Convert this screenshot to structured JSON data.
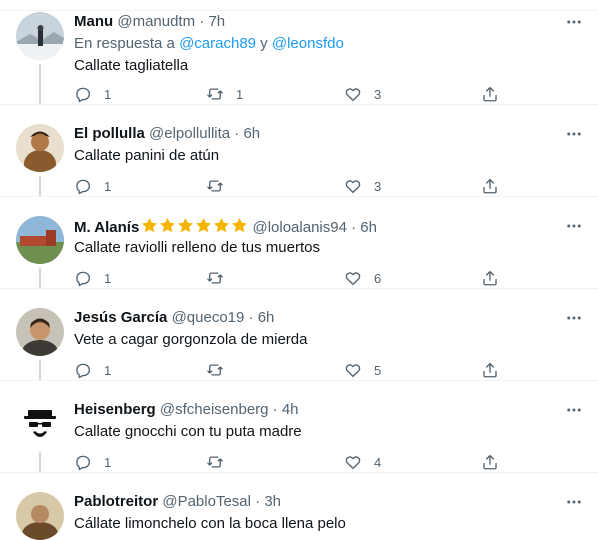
{
  "tweets": [
    {
      "name": "Manu",
      "handle": "@manudtm",
      "time": "7h",
      "reply_prefix": "En respuesta a ",
      "reply_mention_1": "@carach89",
      "reply_join": " y ",
      "reply_mention_2": "@leonsfdo",
      "text": "Callate tagliatella",
      "replies": "1",
      "retweets": "1",
      "likes": "3"
    },
    {
      "name": "El pollulla",
      "handle": "@elpollullita",
      "time": "6h",
      "text": "Callate panini de atún",
      "replies": "1",
      "retweets": "",
      "likes": "3"
    },
    {
      "name": "M. Alanís",
      "handle": "@loloalanis94",
      "time": "6h",
      "text": "Callate raviolli relleno de tus muertos",
      "replies": "1",
      "retweets": "",
      "likes": "6",
      "name_emoji": "star-emoji",
      "emoji_color": "#f4b400"
    },
    {
      "name": "Jesús García",
      "handle": "@queco19",
      "time": "6h",
      "text": "Vete a cagar gorgonzola de mierda",
      "replies": "1",
      "retweets": "",
      "likes": "5"
    },
    {
      "name": "Heisenberg",
      "handle": "@sfcheisenberg",
      "time": "4h",
      "text": "Callate gnocchi con tu puta madre",
      "replies": "1",
      "retweets": "",
      "likes": "4"
    },
    {
      "name": "Pablotreitor",
      "handle": "@PabloTesal",
      "time": "3h",
      "text": "Cállate limonchelo con la boca llena pelo"
    }
  ],
  "separator": "·",
  "icons": {
    "reply": "reply-icon",
    "retweet": "retweet-icon",
    "like": "heart-icon",
    "share": "share-icon",
    "more": "more-icon"
  },
  "colors": {
    "text": "#0f1419",
    "secondary": "#536471",
    "accent": "#1d9bf0",
    "divider": "#eff3f4",
    "thread_line": "#cfd9de"
  }
}
